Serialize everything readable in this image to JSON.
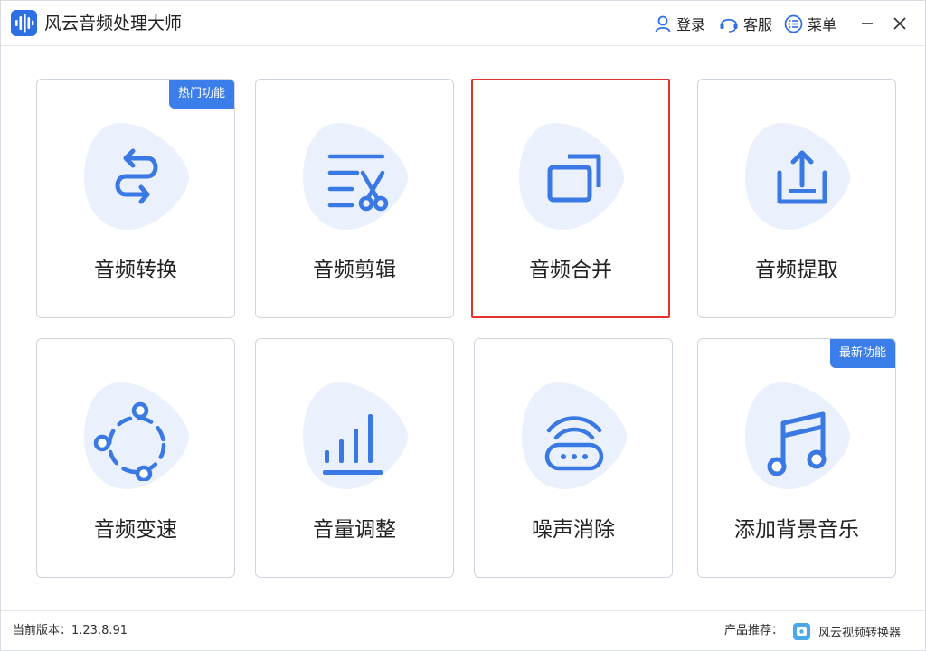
{
  "app": {
    "title": "风云音频处理大师"
  },
  "titlebar": {
    "login_label": "登录",
    "service_label": "客服",
    "menu_label": "菜单"
  },
  "colors": {
    "accent": "#3b7de9",
    "icon_blue": "#3a78e4",
    "blob": "#eaf1fc",
    "selected_border": "#e5322d"
  },
  "cards": [
    {
      "label": "音频转换",
      "badge": "热门功能",
      "icon": "convert-arrows-icon"
    },
    {
      "label": "音频剪辑",
      "badge": "",
      "icon": "scissors-icon"
    },
    {
      "label": "音频合并",
      "badge": "",
      "icon": "merge-windows-icon",
      "selected": true
    },
    {
      "label": "音频提取",
      "badge": "",
      "icon": "upload-tray-icon"
    },
    {
      "label": "音频变速",
      "badge": "",
      "icon": "speed-cycle-icon"
    },
    {
      "label": "音量调整",
      "badge": "",
      "icon": "volume-bars-icon"
    },
    {
      "label": "噪声消除",
      "badge": "",
      "icon": "wifi-router-icon"
    },
    {
      "label": "添加背景音乐",
      "badge": "最新功能",
      "icon": "music-note-icon"
    }
  ],
  "status": {
    "version": "当前版本：1.23.8.91",
    "recommend_label": "产品推荐：",
    "recommend_app": "风云视频转换器"
  }
}
